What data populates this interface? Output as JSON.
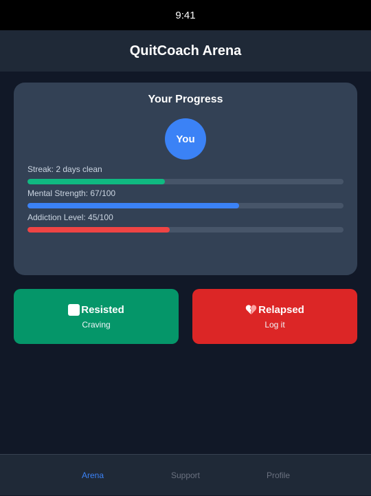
{
  "status_bar": {
    "time": "9:41"
  },
  "header": {
    "title": "QuitCoach Arena"
  },
  "progress": {
    "title": "Your Progress",
    "avatar_label": "You",
    "stats": [
      {
        "label": "Streak: 2 days clean",
        "fraction": 0.435,
        "color": "#10b981"
      },
      {
        "label": "Mental Strength: 67/100",
        "fraction": 0.67,
        "color": "#3b82f6"
      },
      {
        "label": "Addiction Level: 45/100",
        "fraction": 0.45,
        "color": "#ef4444"
      }
    ]
  },
  "actions": {
    "resisted": {
      "title": "Resisted",
      "subtitle": "Craving",
      "color": "#059669",
      "icon": "white-square-icon"
    },
    "relapsed": {
      "title": "Relapsed",
      "subtitle": "Log it",
      "color": "#dc2626",
      "icon": "broken-heart-icon"
    }
  },
  "tabs": [
    {
      "label": "Arena",
      "active": true
    },
    {
      "label": "Support",
      "active": false
    },
    {
      "label": "Profile",
      "active": false
    }
  ],
  "colors": {
    "background": "#111827",
    "header": "#1f2937",
    "card": "#334155",
    "accent": "#3b82f6"
  }
}
